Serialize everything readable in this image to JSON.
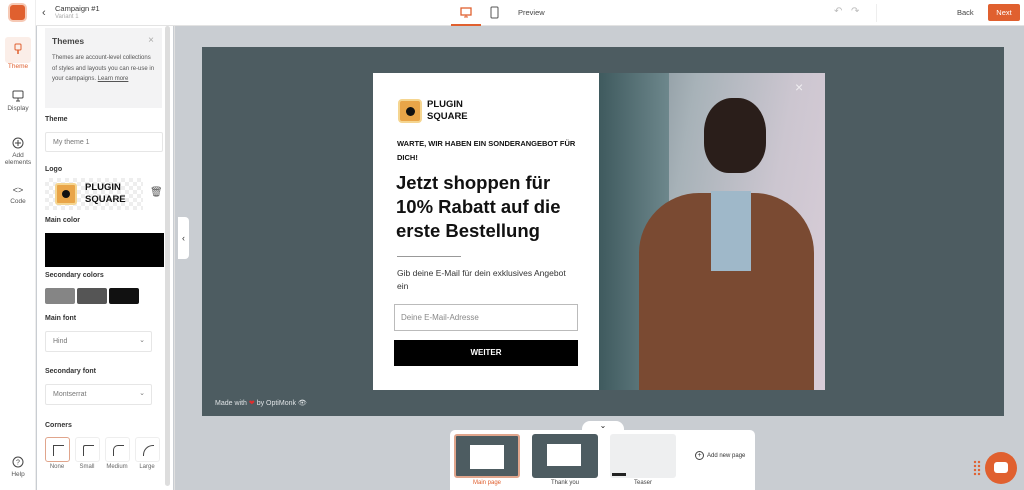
{
  "header": {
    "campaign": "Campaign #1",
    "variant": "Variant 1",
    "preview": "Preview",
    "back": "Back",
    "next": "Next"
  },
  "rail": {
    "items": [
      {
        "label": "Theme"
      },
      {
        "label": "Display"
      },
      {
        "label": "Add elements"
      },
      {
        "label": "Code"
      }
    ],
    "help": "Help"
  },
  "panel": {
    "info_title": "Themes",
    "info_text": "Themes are account-level collections of styles and layouts you can re-use in your campaigns.",
    "info_link": "Learn more",
    "theme_label": "Theme",
    "theme_value": "My theme 1",
    "logo_label": "Logo",
    "logo_text": "PLUGIN SQUARE",
    "main_color_label": "Main color",
    "main_color": "#000000",
    "secondary_label": "Secondary colors",
    "secondary_colors": [
      "#858585",
      "#555555",
      "#111111"
    ],
    "main_font_label": "Main font",
    "main_font": "Hind",
    "secondary_font_label": "Secondary font",
    "secondary_font": "Montserrat",
    "corners_label": "Corners",
    "corners": [
      "None",
      "Small",
      "Medium",
      "Large"
    ]
  },
  "popup": {
    "logo_line1": "PLUGIN",
    "logo_line2": "SQUARE",
    "kicker": "WARTE, WIR HABEN EIN SONDERANGEBOT FÜR DICH!",
    "headline": "Jetzt shoppen für 10% Rabatt auf die erste Bestellung",
    "subtext": "Gib deine E-Mail für dein exklusives Angebot ein",
    "email_placeholder": "Deine E-Mail-Adresse",
    "button": "WEITER",
    "close": "×"
  },
  "footer": {
    "made_with": "Made with",
    "by": "by OptiMonk"
  },
  "pages": {
    "items": [
      "Main page",
      "Thank you",
      "Teaser"
    ],
    "add": "Add new page"
  },
  "accent": "#e0602f"
}
